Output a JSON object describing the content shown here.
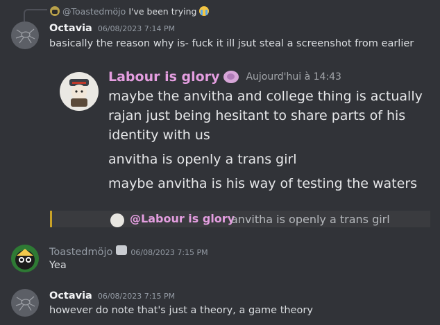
{
  "reply": {
    "user": "@Toastedmöjo",
    "text": "I've been trying"
  },
  "messages": [
    {
      "author": "Octavia",
      "timestamp": "06/08/2023 7:14 PM",
      "text": "basically the reason why is- fuck it ill jsut steal a screenshot from earlier"
    },
    {
      "author": "Toastedmöjo",
      "timestamp": "06/08/2023 7:15 PM",
      "text": "Yea"
    },
    {
      "author": "Octavia",
      "timestamp": "06/08/2023 7:15 PM",
      "text": "however do note that's just a theory, a game theory"
    }
  ],
  "screenshot": {
    "author": "Labour is glory",
    "timestamp": "Aujourd'hui à 14:43",
    "lines": [
      "maybe the anvitha and college thing is actually",
      "rajan just being hesitant to share parts of his",
      "identity with us",
      "anvitha is openly a trans girl",
      "maybe anvitha is his way of testing the waters"
    ],
    "quote_user": "@Labour is glory",
    "quote_text": "anvitha is openly a trans girl"
  },
  "colors": {
    "background": "#313338",
    "role_pink": "#e49ee0",
    "quote_accent": "#c9a227"
  }
}
